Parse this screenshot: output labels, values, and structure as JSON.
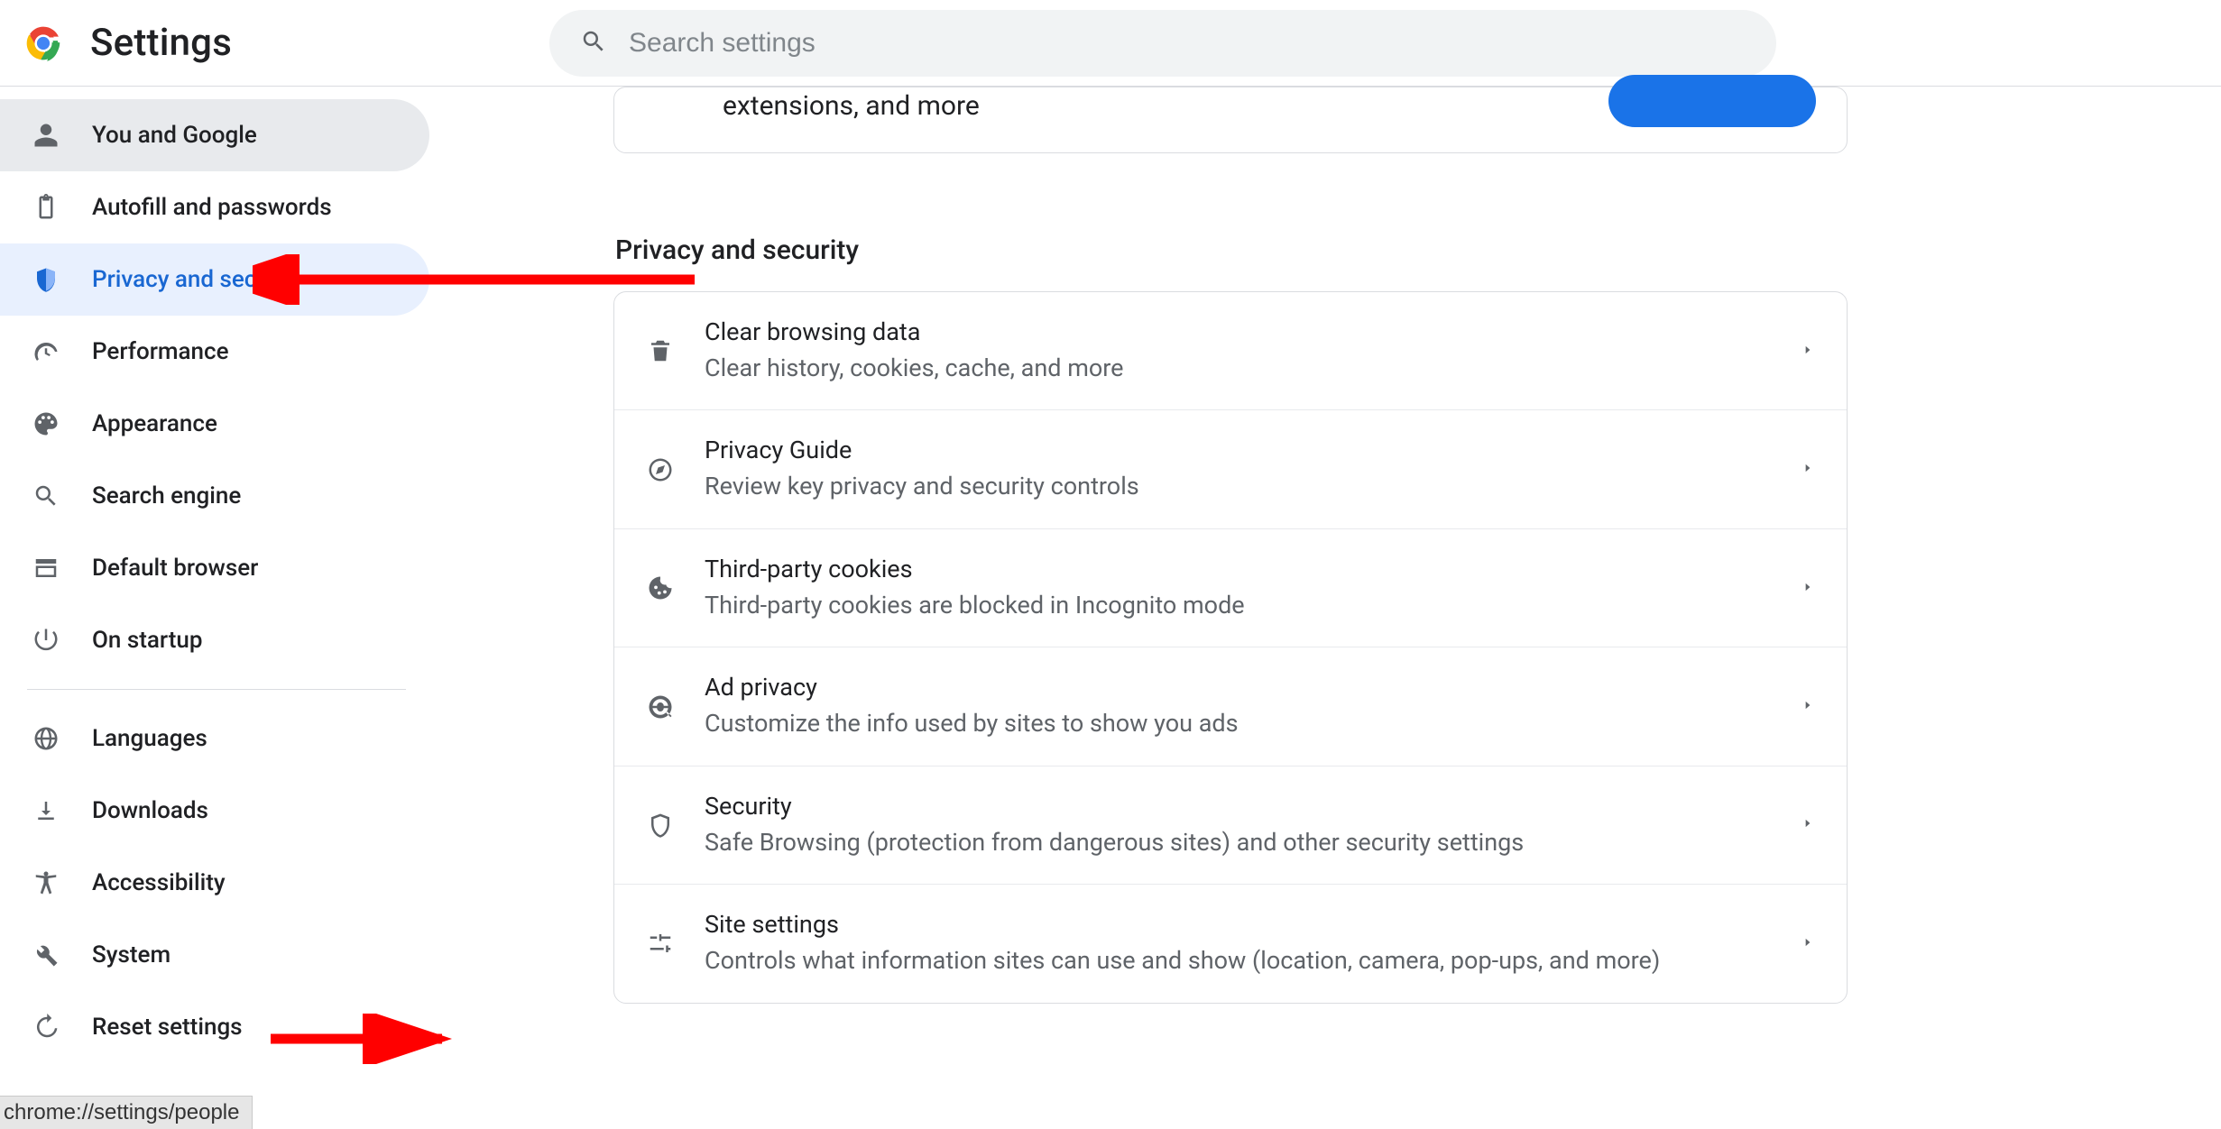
{
  "header": {
    "title": "Settings",
    "search_placeholder": "Search settings"
  },
  "sidebar": {
    "items": [
      {
        "id": "you-google",
        "label": "You and Google",
        "icon": "person"
      },
      {
        "id": "autofill",
        "label": "Autofill and passwords",
        "icon": "clipboard"
      },
      {
        "id": "privacy",
        "label": "Privacy and security",
        "icon": "shield"
      },
      {
        "id": "performance",
        "label": "Performance",
        "icon": "speedometer"
      },
      {
        "id": "appearance",
        "label": "Appearance",
        "icon": "palette"
      },
      {
        "id": "search-engine",
        "label": "Search engine",
        "icon": "search"
      },
      {
        "id": "default-browser",
        "label": "Default browser",
        "icon": "browser"
      },
      {
        "id": "on-startup",
        "label": "On startup",
        "icon": "power"
      },
      {
        "id": "languages",
        "label": "Languages",
        "icon": "globe"
      },
      {
        "id": "downloads",
        "label": "Downloads",
        "icon": "download"
      },
      {
        "id": "accessibility",
        "label": "Accessibility",
        "icon": "accessibility"
      },
      {
        "id": "system",
        "label": "System",
        "icon": "wrench"
      },
      {
        "id": "reset",
        "label": "Reset settings",
        "icon": "restore"
      }
    ],
    "active": "you-google",
    "selected": "privacy",
    "divider_after_index": 7
  },
  "main": {
    "sync_card_text_partial": "extensions, and more",
    "section_heading": "Privacy and security",
    "rows": [
      {
        "id": "clear-data",
        "icon": "trash",
        "title": "Clear browsing data",
        "sub": "Clear history, cookies, cache, and more"
      },
      {
        "id": "privacy-guide",
        "icon": "compass",
        "title": "Privacy Guide",
        "sub": "Review key privacy and security controls"
      },
      {
        "id": "third-party-cookies",
        "icon": "cookie",
        "title": "Third-party cookies",
        "sub": "Third-party cookies are blocked in Incognito mode"
      },
      {
        "id": "ad-privacy",
        "icon": "ad-target",
        "title": "Ad privacy",
        "sub": "Customize the info used by sites to show you ads"
      },
      {
        "id": "security",
        "icon": "shield-outline",
        "title": "Security",
        "sub": "Safe Browsing (protection from dangerous sites) and other security settings"
      },
      {
        "id": "site-settings",
        "icon": "sliders",
        "title": "Site settings",
        "sub": "Controls what information sites can use and show (location, camera, pop-ups, and more)"
      }
    ]
  },
  "status_url": "chrome://settings/people",
  "annotations": {
    "arrow_color": "#ff0000"
  }
}
